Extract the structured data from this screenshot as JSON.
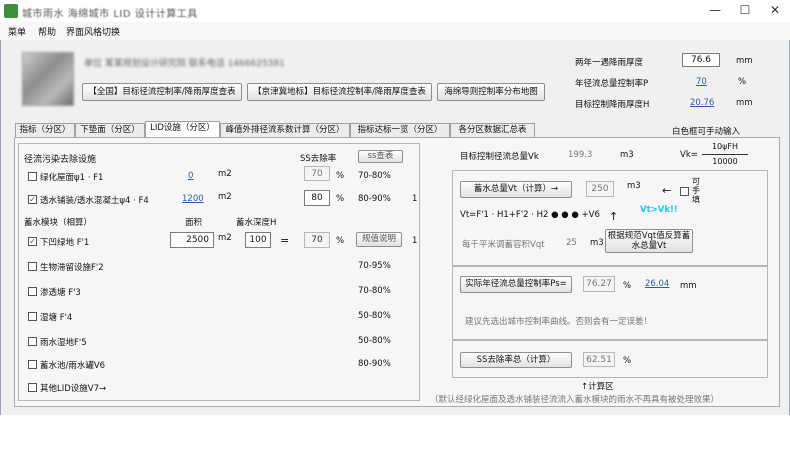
{
  "app": {
    "title": "城市雨水 海绵城市 LID 设计计算工具",
    "menu": [
      "菜单",
      "帮助",
      "界面风格切换"
    ]
  },
  "header": {
    "info_line": "单位 某某规划设计研究院  联系电话 1466625381",
    "buttons": [
      "【全国】目标径流控制率/降雨厚度查表",
      "【京津冀地标】目标径流控制率/降雨厚度查表",
      "海绵导则控制率分布地图"
    ],
    "rain_label": "两年一遇降雨厚度",
    "rain_value": "76.6",
    "rain_unit": "mm",
    "annual_label": "年径流总量控制率P",
    "annual_value": "70",
    "annual_unit": "%",
    "target_label": "目标控制降雨厚度H",
    "target_value": "20.76",
    "target_unit": "mm"
  },
  "tabs": [
    "指标（分区）",
    "下垫面（分区）",
    "LID设施（分区）",
    "峰值外排径流系数计算（分区）",
    "指标达标一览（分区）",
    "各分区数据汇总表"
  ],
  "tab_note": "白色框可手动输入",
  "left": {
    "section_title": "径流污染去除设施",
    "ss_header": "SS去除率",
    "ss_lookup": "ss查表",
    "green_roof": {
      "label": "绿化屋面ψ1 · F1",
      "area": "0",
      "unit": "m2",
      "ss": "70",
      "pct": "%",
      "range": "70-80%"
    },
    "permeable": {
      "label": "透水铺装/透水混凝土ψ4 · F4",
      "area": "1200",
      "unit": "m2",
      "ss": "80",
      "pct": "%",
      "range": "80-90%",
      "count": "1"
    },
    "storage_header": "蓄水模块（相算）",
    "area_header": "面积",
    "depth_header": "蓄水深度H",
    "sunken": {
      "label": "下凹绿地  F'1",
      "area": "2500",
      "unit": "m2",
      "depth": "100",
      "eq": "=",
      "ss": "70",
      "pct": "%",
      "explain": "规值说明",
      "count": "1"
    },
    "others": [
      {
        "label": "生物滞留设施F'2",
        "range": "70-95%"
      },
      {
        "label": "渗透塘  F'3",
        "range": "70-80%"
      },
      {
        "label": "湿塘  F'4",
        "range": "50-80%"
      },
      {
        "label": "雨水湿地F'5",
        "range": "50-80%"
      },
      {
        "label": "蓄水池/雨水罐V6",
        "range": "80-90%"
      },
      {
        "label": "其他LID设施V7→",
        "range": ""
      }
    ]
  },
  "right": {
    "vk_label": "目标控制径流总量Vk",
    "vk_value": "199.3",
    "vk_unit": "m3",
    "vk_formula_lhs": "Vk=",
    "vk_formula_num": "10ψFH",
    "vk_formula_den": "10000",
    "vt_button": "蓄水总量Vt（计算）→",
    "vt_value": "250",
    "vt_unit": "m3",
    "vt_arrow": "←",
    "vt_manual": "可手填",
    "vt_formula": "Vt=F'1 · H1+F'2 · H2 ● ● ● +V6",
    "vt_compare": "Vt>Vk!!",
    "vqt_label": "每千平米调蓄容积Vqt",
    "vqt_value": "25",
    "vqt_unit": "m3",
    "reverse_button": "根据规范Vqt值反算蓄水总量Vt",
    "ps_button": "实际年径流总量控制率Ps=",
    "ps_value": "76.27",
    "ps_pct": "%",
    "ps_rain": "26.04",
    "ps_unit": "mm",
    "ps_note": "建议先选出城市控制率曲线。否则会有一定误差！",
    "ss_button": "SS去除率总（计算）",
    "ss_value": "62.51",
    "ss_pct": "%",
    "calc_area": "↑计算区",
    "footnote": "（默认经绿化屋面及透水铺装径流流入蓄水模块的雨水不再具有被处理效果）"
  },
  "colors": {
    "accent_cyan": "#18c8f0",
    "link_blue": "#2a5aa8"
  }
}
